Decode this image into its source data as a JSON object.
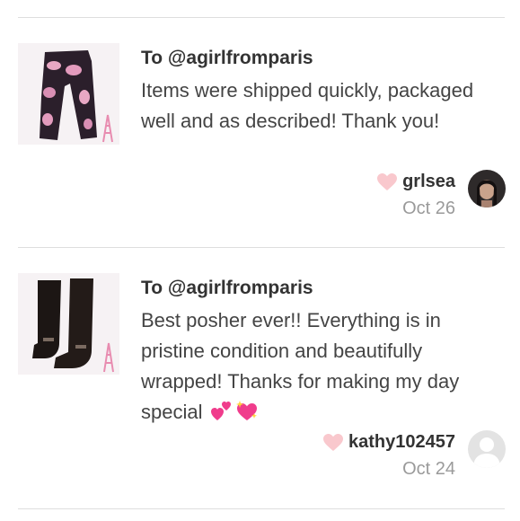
{
  "reviews": [
    {
      "to": "To @agirlfromparis",
      "message": "Items were shipped quickly, packaged well and as described! Thank you!",
      "user": "grlsea",
      "date": "Oct 26",
      "thumb_icon": "pink-camo-pants-thumbnail",
      "avatar_icon": "user-photo-avatar"
    },
    {
      "to": "To @agirlfromparis",
      "message": "Best posher ever!! Everything is in pristine condition and beautifully wrapped! Thanks for making my day special",
      "emojis": [
        "two-hearts-emoji",
        "sparkling-heart-emoji"
      ],
      "user": "kathy102457",
      "date": "Oct 24",
      "thumb_icon": "black-boots-thumbnail",
      "avatar_icon": "default-avatar"
    }
  ],
  "colors": {
    "heart": "#f9c8cd",
    "divider": "#dedede",
    "date": "#9a9a9a",
    "emoji_pink": "#f03c8c"
  }
}
